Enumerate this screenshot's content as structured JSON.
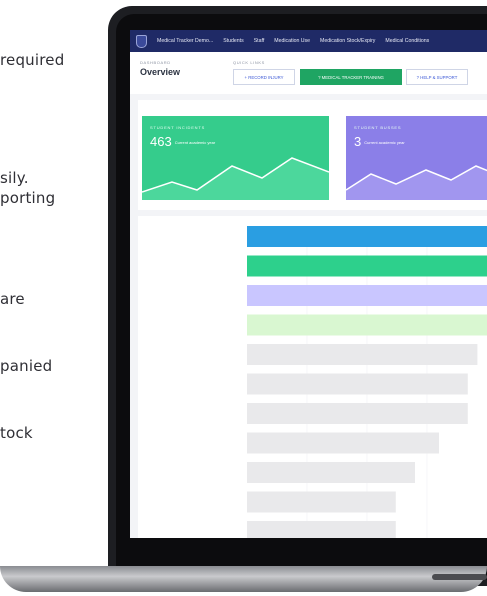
{
  "side_text": [
    "required",
    "sily.",
    "porting",
    "are",
    "panied",
    "tock"
  ],
  "app": {
    "nav_items": [
      "Medical Tracker Demo...",
      "Students",
      "Staff",
      "Medication Use",
      "Medication Stock/Expiry",
      "Medical Conditions"
    ],
    "breadcrumb": "DASHBOARD",
    "page_title": "Overview",
    "quick_links_label": "QUICK LINKS",
    "quick_links": [
      {
        "label": "+ RECORD INJURY",
        "style": "outline"
      },
      {
        "label": "? MEDICAL TRACKER TRAINING",
        "style": "primary"
      },
      {
        "label": "? HELP & SUPPORT",
        "style": "outline"
      }
    ],
    "cards": [
      {
        "label": "STUDENT INCIDENTS",
        "value": "463",
        "caption": "Current academic year",
        "color": "#35cc8c"
      },
      {
        "label": "STUDENT BUSSES",
        "value": "3",
        "caption": "Current academic year",
        "color": "#8b7fe8"
      }
    ]
  },
  "colors": {
    "nav_bg": "#1f2a66",
    "primary_green": "#1fa563",
    "bar_blue": "#2a9ee2",
    "bar_green": "#2dd08c",
    "bar_lavender": "#c9c6ff",
    "bar_mint": "#d9f7d1",
    "bar_grey": "#e9e9eb"
  },
  "chart_data": {
    "type": "bar",
    "orientation": "horizontal",
    "categories": [
      "",
      "",
      "",
      "",
      "",
      "",
      "",
      "",
      "",
      "",
      ""
    ],
    "series": [
      {
        "values": [
          1.0,
          1.0,
          1.0,
          1.0,
          0.96,
          0.92,
          0.92,
          0.8,
          0.7,
          0.62,
          0.62
        ]
      }
    ],
    "bar_colors": [
      "#2a9ee2",
      "#2dd08c",
      "#c9c6ff",
      "#d9f7d1",
      "#e9e9eb",
      "#e9e9eb",
      "#e9e9eb",
      "#e9e9eb",
      "#e9e9eb",
      "#e9e9eb",
      "#e9e9eb"
    ],
    "xlim": [
      0,
      1.0
    ],
    "grid": true,
    "title": "",
    "xlabel": "",
    "ylabel": ""
  }
}
